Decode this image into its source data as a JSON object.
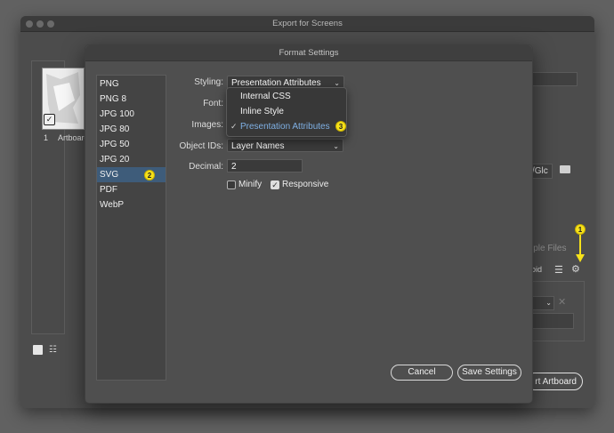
{
  "outer_window": {
    "title": "Export for Screens",
    "artboard_index": "1",
    "artboard_name": "Artboard",
    "path_fragment": "/Glc",
    "partial_label_files": "iple Files",
    "partial_label_oid": "oid",
    "export_button": "rt Artboard"
  },
  "dialog": {
    "title": "Format Settings",
    "formats": [
      "PNG",
      "PNG 8",
      "JPG 100",
      "JPG 80",
      "JPG 50",
      "JPG 20",
      "SVG",
      "PDF",
      "WebP"
    ],
    "selected_format": "SVG",
    "styling": {
      "label": "Styling:",
      "value": "Presentation Attributes"
    },
    "font": {
      "label": "Font:"
    },
    "images": {
      "label": "Images:"
    },
    "object_ids": {
      "label": "Object IDs:",
      "value": "Layer Names"
    },
    "decimal": {
      "label": "Decimal:",
      "value": "2"
    },
    "minify": {
      "label": "Minify",
      "checked": false
    },
    "responsive": {
      "label": "Responsive",
      "checked": true
    },
    "styling_menu": [
      {
        "label": "Internal CSS",
        "checked": false
      },
      {
        "label": "Inline Style",
        "checked": false
      },
      {
        "label": "Presentation Attributes",
        "checked": true
      }
    ],
    "cancel_button": "Cancel",
    "save_button": "Save Settings"
  },
  "annotations": {
    "badge1": "1",
    "badge2": "2",
    "badge3": "3",
    "arrow_color": "#f6e11a"
  },
  "colors": {
    "selection": "#3e5c7a",
    "menu_active_text": "#7fb0e4"
  }
}
